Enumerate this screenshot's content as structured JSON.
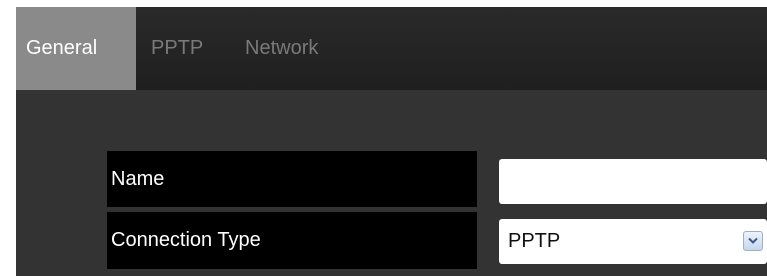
{
  "tabs": [
    {
      "label": "General",
      "active": true
    },
    {
      "label": "PPTP",
      "active": false
    },
    {
      "label": "Network",
      "active": false
    }
  ],
  "form": {
    "name": {
      "label": "Name",
      "value": ""
    },
    "connection_type": {
      "label": "Connection Type",
      "value": "PPTP"
    }
  },
  "icons": {
    "select_arrow": "chevron-down-icon"
  },
  "colors": {
    "active_tab": "#8a8a8a",
    "panel_background": "#333333",
    "label_background": "#000000"
  }
}
